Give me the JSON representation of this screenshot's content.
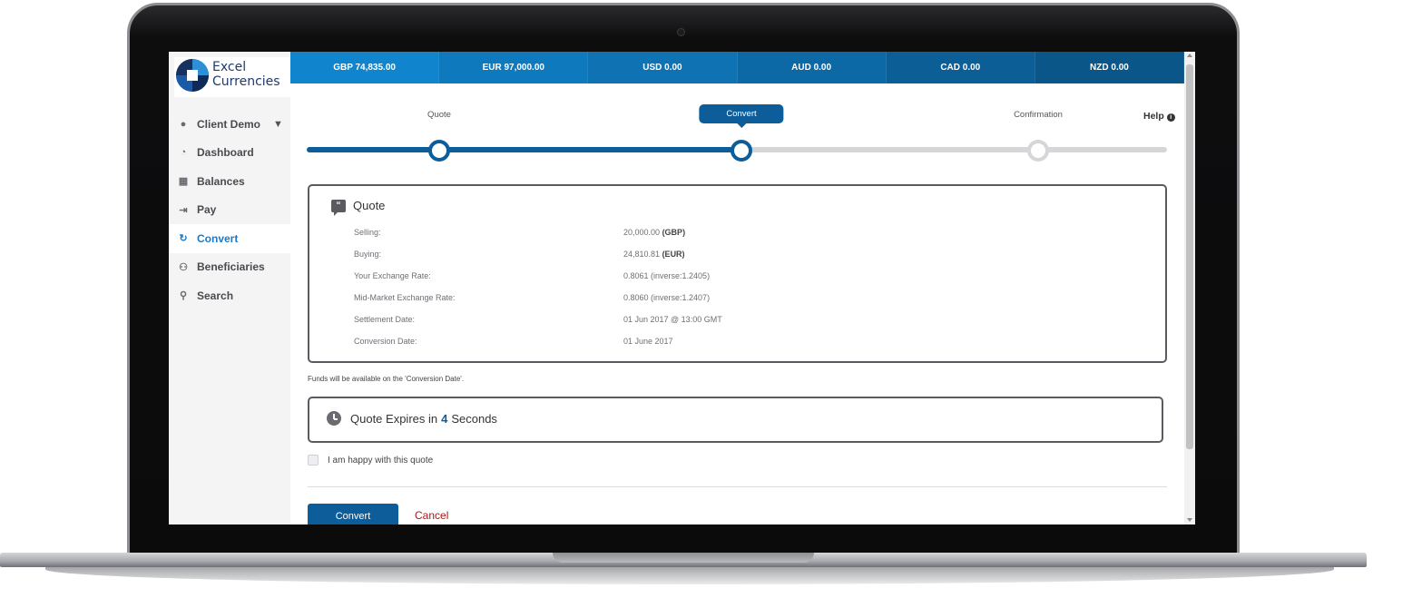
{
  "brand": {
    "line1": "Excel",
    "line2": "Currencies",
    "colors": {
      "primary": "#0c5d9a",
      "accent": "#1a7ac7",
      "cancel": "#a61b1b"
    }
  },
  "sidebar": {
    "items": [
      {
        "label": "Client Demo",
        "icon": "user-icon",
        "glyph": "●"
      },
      {
        "label": "Dashboard",
        "icon": "dashboard-icon",
        "glyph": "◔"
      },
      {
        "label": "Balances",
        "icon": "calculator-icon",
        "glyph": "▦"
      },
      {
        "label": "Pay",
        "icon": "sign-out-icon",
        "glyph": "⇥"
      },
      {
        "label": "Convert",
        "icon": "refresh-icon",
        "glyph": "↻"
      },
      {
        "label": "Beneficiaries",
        "icon": "users-icon",
        "glyph": "⚇"
      },
      {
        "label": "Search",
        "icon": "search-icon",
        "glyph": "⚲"
      }
    ]
  },
  "balances": [
    {
      "label": "GBP 74,835.00",
      "color": "#1084cc"
    },
    {
      "label": "EUR 97,000.00",
      "color": "#0f79bd"
    },
    {
      "label": "USD 0.00",
      "color": "#0f72b2"
    },
    {
      "label": "AUD 0.00",
      "color": "#0d69a6"
    },
    {
      "label": "CAD 0.00",
      "color": "#0c5f96"
    },
    {
      "label": "NZD 0.00",
      "color": "#0b5688"
    }
  ],
  "stepper": {
    "steps": [
      "Quote",
      "Convert",
      "Confirmation"
    ],
    "active_index": 1,
    "help_label": "Help"
  },
  "quote": {
    "title": "Quote",
    "rows": [
      {
        "label": "Selling:",
        "value": "20,000.00",
        "suffix": "(GBP)"
      },
      {
        "label": "Buying:",
        "value": "24,810.81",
        "suffix": "(EUR)"
      },
      {
        "label": "Your Exchange Rate:",
        "value": "0.8061 (inverse:1.2405)",
        "suffix": ""
      },
      {
        "label": "Mid-Market Exchange Rate:",
        "value": "0.8060 (inverse:1.2407)",
        "suffix": ""
      },
      {
        "label": "Settlement Date:",
        "value": "01 Jun 2017 @ 13:00 GMT",
        "suffix": ""
      },
      {
        "label": "Conversion Date:",
        "value": "01 June 2017",
        "suffix": ""
      }
    ]
  },
  "funds_note": "Funds will be available on the 'Conversion Date'.",
  "expiry": {
    "prefix": "Quote Expires in",
    "seconds": "4",
    "suffix": "Seconds"
  },
  "agree_label": "I am happy with this quote",
  "actions": {
    "convert_label": "Convert",
    "cancel_label": "Cancel"
  }
}
